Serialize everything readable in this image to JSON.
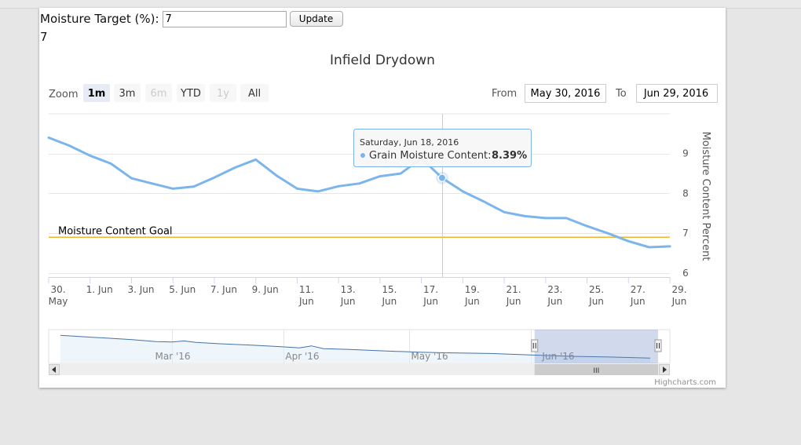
{
  "form": {
    "label": "Moisture Target (%):",
    "input_value": "7",
    "button_label": "Update",
    "echo_value": "7"
  },
  "range_selector": {
    "zoom_label": "Zoom",
    "buttons": [
      {
        "label": "1m",
        "state": "selected"
      },
      {
        "label": "3m",
        "state": "normal"
      },
      {
        "label": "6m",
        "state": "disabled"
      },
      {
        "label": "YTD",
        "state": "normal"
      },
      {
        "label": "1y",
        "state": "disabled"
      },
      {
        "label": "All",
        "state": "normal"
      }
    ],
    "from_label": "From",
    "from_value": "May 30, 2016",
    "to_label": "To",
    "to_value": "Jun 29, 2016"
  },
  "tooltip": {
    "date": "Saturday, Jun 18, 2016",
    "series_label": "Grain Moisture Content:",
    "value_text": "8.39%",
    "x": 19,
    "y": 8.39
  },
  "navigator": {
    "labels": [
      "Mar '16",
      "Apr '16",
      "May '16",
      "Jun '16"
    ],
    "scroll_grip": "III"
  },
  "credits": "Highcharts.com",
  "colors": {
    "series": "#7cb5ec",
    "goal_line": "#f0b432",
    "navigator_mask": "rgba(102,133,194,0.3)"
  },
  "chart_data": {
    "type": "line",
    "title": "Infield Drydown",
    "ylabel": "Moisture Content Percent",
    "ylim": [
      5.9,
      10
    ],
    "yticks": [
      6,
      7,
      8,
      9
    ],
    "xlim": [
      0,
      30
    ],
    "xticks": [
      {
        "x": 0,
        "l1": "30.",
        "l2": "May"
      },
      {
        "x": 2,
        "l1": "1. Jun",
        "l2": ""
      },
      {
        "x": 4,
        "l1": "3. Jun",
        "l2": ""
      },
      {
        "x": 6,
        "l1": "5. Jun",
        "l2": ""
      },
      {
        "x": 8,
        "l1": "7. Jun",
        "l2": ""
      },
      {
        "x": 10,
        "l1": "9. Jun",
        "l2": ""
      },
      {
        "x": 12,
        "l1": "11.",
        "l2": "Jun"
      },
      {
        "x": 14,
        "l1": "13.",
        "l2": "Jun"
      },
      {
        "x": 16,
        "l1": "15.",
        "l2": "Jun"
      },
      {
        "x": 18,
        "l1": "17.",
        "l2": "Jun"
      },
      {
        "x": 20,
        "l1": "19.",
        "l2": "Jun"
      },
      {
        "x": 22,
        "l1": "21.",
        "l2": "Jun"
      },
      {
        "x": 24,
        "l1": "23.",
        "l2": "Jun"
      },
      {
        "x": 26,
        "l1": "25.",
        "l2": "Jun"
      },
      {
        "x": 28,
        "l1": "27.",
        "l2": "Jun"
      },
      {
        "x": 30,
        "l1": "29.",
        "l2": "Jun"
      }
    ],
    "series": [
      {
        "name": "Grain Moisture Content",
        "x": [
          0,
          1,
          2,
          3,
          4,
          5,
          6,
          7,
          8,
          9,
          10,
          11,
          12,
          13,
          14,
          15,
          16,
          17,
          18,
          19,
          20,
          21,
          22,
          23,
          24,
          25,
          26,
          27,
          28,
          29,
          30
        ],
        "y": [
          9.4,
          9.2,
          8.95,
          8.75,
          8.38,
          8.25,
          8.12,
          8.17,
          8.4,
          8.65,
          8.85,
          8.45,
          8.12,
          8.05,
          8.18,
          8.25,
          8.43,
          8.5,
          8.88,
          8.39,
          8.05,
          7.8,
          7.53,
          7.43,
          7.38,
          7.38,
          7.18,
          7.0,
          6.8,
          6.65,
          6.67
        ]
      }
    ],
    "plot_lines": [
      {
        "label": "Moisture Content Goal",
        "value": 6.9
      }
    ],
    "navigator_series": [
      {
        "x": 0,
        "y": 9.9
      },
      {
        "x": 6,
        "y": 9.7
      },
      {
        "x": 12,
        "y": 9.5
      },
      {
        "x": 18,
        "y": 9.3
      },
      {
        "x": 24,
        "y": 9.0
      },
      {
        "x": 28,
        "y": 8.95
      },
      {
        "x": 31,
        "y": 9.1
      },
      {
        "x": 34,
        "y": 8.9
      },
      {
        "x": 40,
        "y": 8.7
      },
      {
        "x": 48,
        "y": 8.5
      },
      {
        "x": 55,
        "y": 8.3
      },
      {
        "x": 60,
        "y": 8.1
      },
      {
        "x": 63,
        "y": 8.4
      },
      {
        "x": 66,
        "y": 8.0
      },
      {
        "x": 72,
        "y": 7.9
      },
      {
        "x": 80,
        "y": 7.7
      },
      {
        "x": 90,
        "y": 7.5
      },
      {
        "x": 98,
        "y": 7.4
      },
      {
        "x": 108,
        "y": 7.3
      },
      {
        "x": 118,
        "y": 7.1
      },
      {
        "x": 128,
        "y": 6.9
      },
      {
        "x": 138,
        "y": 6.8
      },
      {
        "x": 148,
        "y": 6.65
      }
    ],
    "navigator_ylim": [
      6,
      10.5
    ],
    "navigator_xlim": [
      0,
      150
    ],
    "navigator_range": [
      119,
      150
    ],
    "grid": true
  }
}
